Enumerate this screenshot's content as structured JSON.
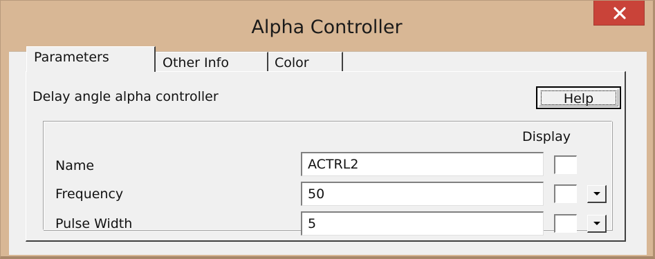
{
  "window": {
    "title": "Alpha Controller",
    "close_icon": "close-x-icon",
    "titlebar_color": "#d8b795",
    "close_color": "#c94339"
  },
  "tabs": [
    {
      "label": "Parameters",
      "selected": true
    },
    {
      "label": "Other Info",
      "selected": false
    },
    {
      "label": "Color",
      "selected": false
    }
  ],
  "panel": {
    "description": "Delay angle alpha controller",
    "help_label": "Help",
    "display_header": "Display"
  },
  "fields": [
    {
      "label": "Name",
      "value": "ACTRL2",
      "display_checked": false,
      "has_dropdown": false
    },
    {
      "label": "Frequency",
      "value": "50",
      "display_checked": false,
      "has_dropdown": true
    },
    {
      "label": "Pulse Width",
      "value": "5",
      "display_checked": false,
      "has_dropdown": true
    }
  ]
}
